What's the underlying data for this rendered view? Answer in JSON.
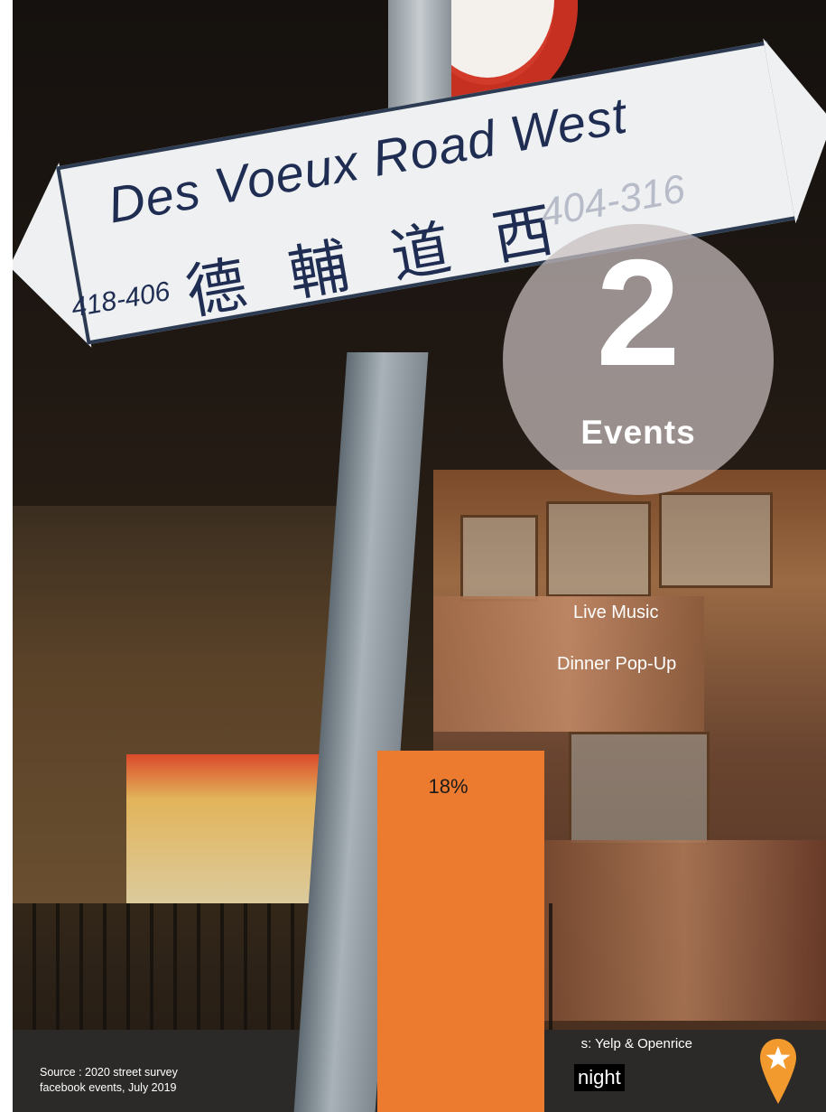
{
  "street_sign": {
    "name_en": "Des Voeux Road West",
    "name_zh": "德 輔 道 西",
    "number_left": "418-406",
    "number_right": "404-316"
  },
  "event_badge": {
    "count": "2",
    "label": "Events"
  },
  "categories": [
    {
      "label": "Live Music"
    },
    {
      "label": "Dinner  Pop-Up"
    }
  ],
  "chart_data": {
    "type": "bar",
    "values": [
      18
    ],
    "data_labels": [
      "18%"
    ],
    "category": "night",
    "bar_color": "#ec7a2f"
  },
  "sources": {
    "left_line1": "Source : 2020 street survey",
    "left_line2": "facebook events, July 2019",
    "right": "s: Yelp & Openrice",
    "tag": "night"
  },
  "colors": {
    "accent": "#ec7a2f",
    "badge": "#c8bebe"
  },
  "icons": {
    "pin": "map-pin-star-icon"
  }
}
